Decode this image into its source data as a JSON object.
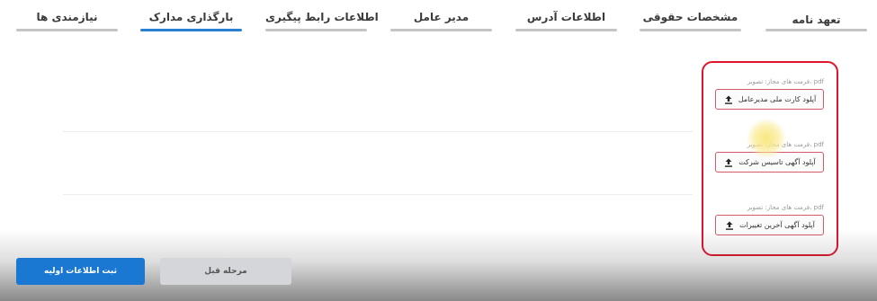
{
  "tabs": [
    {
      "label": "تعهد نامه",
      "active": false
    },
    {
      "label": "مشخصات حقوقی",
      "active": false
    },
    {
      "label": "اطلاعات آدرس",
      "active": false
    },
    {
      "label": "مدیر عامل",
      "active": false
    },
    {
      "label": "اطلاعات رابط پیگیری",
      "active": false
    },
    {
      "label": "بارگذاری مدارک",
      "active": true
    },
    {
      "label": "نیازمندی ها",
      "active": false
    }
  ],
  "uploads": [
    {
      "format_hint": "فرمت های مجاز: تصویر، pdf",
      "label": "آپلود کارت ملی مدیرعامل",
      "icon": "upload-icon"
    },
    {
      "format_hint": "فرمت های مجاز: تصویر، pdf",
      "label": "آپلود آگهی تاسیس شرکت",
      "icon": "upload-icon"
    },
    {
      "format_hint": "فرمت های مجاز: تصویر، pdf",
      "label": "آپلود آگهی آخرین تغییرات",
      "icon": "upload-icon"
    }
  ],
  "footer": {
    "submit_label": "ثبت اطلاعات اولیه",
    "prev_label": "مرحله قبل"
  },
  "colors": {
    "accent": "#1a78d2",
    "active_tab_underline": "#2a7fd0",
    "highlight_frame": "#e0142a",
    "upload_border": "#d65b6a"
  }
}
